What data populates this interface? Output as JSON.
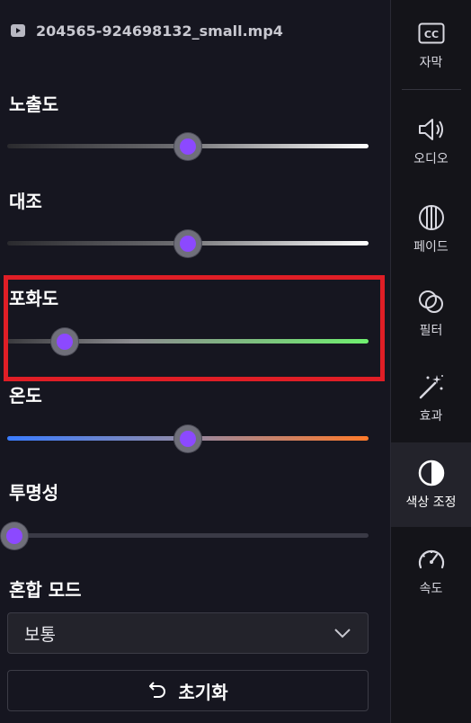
{
  "file": {
    "name": "204565-924698132_small.mp4",
    "icon": "video-file-icon"
  },
  "adjustments": {
    "exposure": {
      "label": "노출도",
      "value_fraction": 0.5
    },
    "contrast": {
      "label": "대조",
      "value_fraction": 0.5
    },
    "saturation": {
      "label": "포화도",
      "value_fraction": 0.16
    },
    "temperature": {
      "label": "온도",
      "value_fraction": 0.5
    },
    "opacity": {
      "label": "투명성",
      "value_fraction": 0.02
    }
  },
  "blend": {
    "label": "혼합 모드",
    "selected": "보통"
  },
  "reset": {
    "label": "초기화"
  },
  "rail": {
    "items": [
      {
        "label": "자막",
        "icon": "captions-icon"
      },
      {
        "label": "오디오",
        "icon": "speaker-icon"
      },
      {
        "label": "페이드",
        "icon": "fade-icon"
      },
      {
        "label": "필터",
        "icon": "filter-icon"
      },
      {
        "label": "효과",
        "icon": "magic-wand-icon"
      },
      {
        "label": "색상 조정",
        "icon": "color-adjust-icon",
        "active": true
      },
      {
        "label": "속도",
        "icon": "speedometer-icon"
      }
    ]
  },
  "colors": {
    "accent_thumb": "#8c49ff",
    "highlight": "#e01e26"
  }
}
